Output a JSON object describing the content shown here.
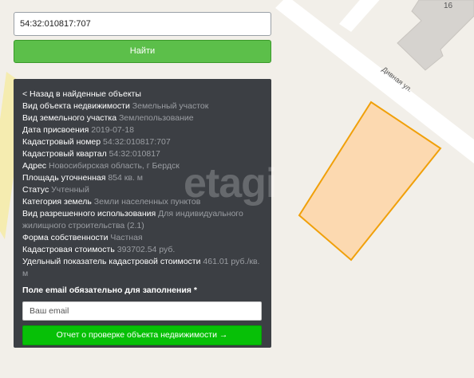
{
  "search": {
    "value": "54:32:010817:707"
  },
  "find_button": {
    "label": "Найти"
  },
  "panel": {
    "back_label": "< Назад в найденные объекты",
    "rows": [
      {
        "key": "Вид объекта недвижимости",
        "value": "Земельный участок"
      },
      {
        "key": "Вид земельного участка",
        "value": "Землепользование"
      },
      {
        "key": "Дата присвоения",
        "value": "2019-07-18"
      },
      {
        "key": "Кадастровый номер",
        "value": "54:32:010817:707"
      },
      {
        "key": "Кадастровый квартал",
        "value": "54:32:010817"
      },
      {
        "key": "Адрес",
        "value": "Новосибирская область, г Бердск"
      },
      {
        "key": "Площадь уточненная",
        "value": "854 кв. м"
      },
      {
        "key": "Статус",
        "value": "Учтенный"
      },
      {
        "key": "Категория земель",
        "value": "Земли населенных пунктов"
      },
      {
        "key": "Вид разрешенного использования",
        "value": "Для индивидуального жилищного строительства (2.1)"
      },
      {
        "key": "Форма собственности",
        "value": "Частная"
      },
      {
        "key": "Кадастровая стоимость",
        "value": "393702.54 руб."
      },
      {
        "key": "Удельный показатель кадастровой стоимости",
        "value": "461.01 руб./кв. м"
      }
    ],
    "email_label": "Поле email обязательно для заполнения *",
    "email_placeholder": "Ваш email",
    "report_button": "Отчет о проверке объекта недвижимости →"
  },
  "map": {
    "street_label": "Дивная ул.",
    "house_number": "16",
    "watermark": "etagi",
    "colors": {
      "parcel_fill": "#fcd9b0",
      "parcel_border": "#f0a00a",
      "road_yellow": "#f5ecb0"
    }
  }
}
